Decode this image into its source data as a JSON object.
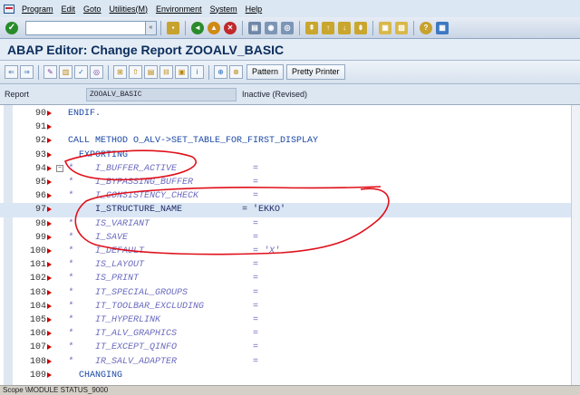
{
  "menu": [
    "Program",
    "Edit",
    "Goto",
    "Utilities(M)",
    "Environment",
    "System",
    "Help"
  ],
  "title": "ABAP Editor: Change Report ZOOALV_BASIC",
  "toolbar": {
    "pattern_label": "Pattern",
    "pretty_printer_label": "Pretty Printer"
  },
  "report": {
    "label": "Report",
    "name": "ZOOALV_BASIC",
    "status": "Inactive (Revised)"
  },
  "code_lines": [
    {
      "num": "90",
      "code": "ENDIF.",
      "comment": false
    },
    {
      "num": "91",
      "code": "",
      "comment": false
    },
    {
      "num": "92",
      "code": "CALL METHOD O_ALV->SET_TABLE_FOR_FIRST_DISPLAY",
      "comment": false
    },
    {
      "num": "93",
      "code": "  EXPORTING",
      "comment": false
    },
    {
      "num": "94",
      "code": "*    I_BUFFER_ACTIVE              =",
      "comment": true
    },
    {
      "num": "95",
      "code": "*    I_BYPASSING_BUFFER           =",
      "comment": true
    },
    {
      "num": "96",
      "code": "*    I_CONSISTENCY_CHECK          =",
      "comment": true
    },
    {
      "num": "97",
      "code": "     I_STRUCTURE_NAME           = 'EKKO'",
      "comment": false
    },
    {
      "num": "98",
      "code": "*    IS_VARIANT                   =",
      "comment": true
    },
    {
      "num": "99",
      "code": "*    I_SAVE                       =",
      "comment": true
    },
    {
      "num": "100",
      "code": "*    I_DEFAULT                    = 'X'",
      "comment": true
    },
    {
      "num": "101",
      "code": "*    IS_LAYOUT                    =",
      "comment": true
    },
    {
      "num": "102",
      "code": "*    IS_PRINT                     =",
      "comment": true
    },
    {
      "num": "103",
      "code": "*    IT_SPECIAL_GROUPS            =",
      "comment": true
    },
    {
      "num": "104",
      "code": "*    IT_TOOLBAR_EXCLUDING         =",
      "comment": true
    },
    {
      "num": "105",
      "code": "*    IT_HYPERLINK                 =",
      "comment": true
    },
    {
      "num": "106",
      "code": "*    IT_ALV_GRAPHICS              =",
      "comment": true
    },
    {
      "num": "107",
      "code": "*    IT_EXCEPT_QINFO              =",
      "comment": true
    },
    {
      "num": "108",
      "code": "*    IR_SALV_ADAPTER              =",
      "comment": true
    },
    {
      "num": "109",
      "code": "  CHANGING",
      "comment": false
    }
  ],
  "statusbar": "Scope \\MODULE STATUS_9000"
}
